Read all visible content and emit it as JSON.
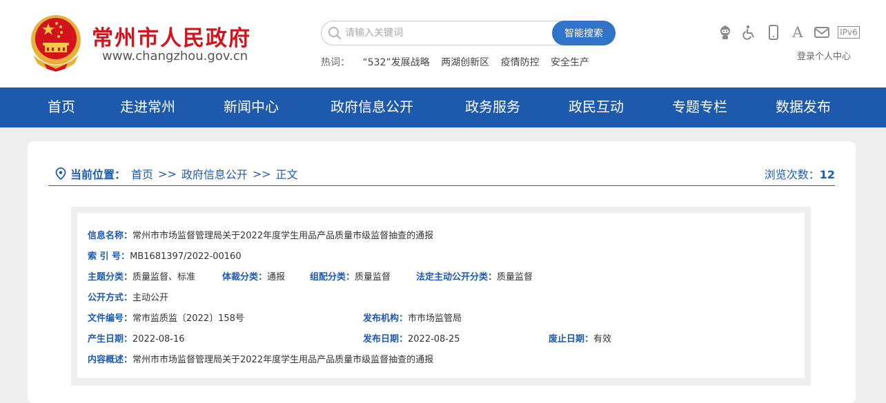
{
  "header": {
    "site_name": "常州市人民政府",
    "site_url": "www.changzhou.gov.cn",
    "emblem_icon": "national-emblem-icon",
    "brand_color": "#d3141d"
  },
  "search": {
    "placeholder": "请输入关键词",
    "value": "",
    "button_label": "智能搜索",
    "button_color": "#2f74c9"
  },
  "hot": {
    "label": "热词：",
    "items": [
      "“532”发展战略",
      "两湖创新区",
      "疫情防控",
      "安全生产"
    ]
  },
  "tools": {
    "icons": [
      "robot-icon",
      "accessibility-icon",
      "mobile-icon",
      "font-size-icon",
      "mail-icon",
      "ipv6-icon"
    ],
    "ipv6_text": "IPv6",
    "font_text": "A",
    "login_label": "登录个人中心"
  },
  "nav": {
    "bg_color": "#1d5aad",
    "items": [
      "首页",
      "走进常州",
      "新闻中心",
      "政府信息公开",
      "政务服务",
      "政民互动",
      "专题专栏",
      "数据发布"
    ]
  },
  "breadcrumb": {
    "label": "当前位置：",
    "items": [
      "首页",
      "政府信息公开",
      "正文"
    ],
    "separator": ">>"
  },
  "views": {
    "label": "浏览次数：",
    "count": "12"
  },
  "info": {
    "name_label": "信息名称：",
    "name_value": "常州市市场监督管理局关于2022年度学生用品产品质量市级监督抽查的通报",
    "index_label": "索 引 号：",
    "index_value": "MB1681397/2022-00160",
    "topic_label": "主题分类：",
    "topic_value": "质量监督、标准",
    "genre_label": "体裁分类：",
    "genre_value": "通报",
    "org_cat_label": "组配分类：",
    "org_cat_value": "质量监督",
    "legal_label": "法定主动公开分类：",
    "legal_value": "质量监督",
    "open_label": "公开方式：",
    "open_value": "主动公开",
    "doc_no_label": "文件编号：",
    "doc_no_value": "常市监质监〔2022〕158号",
    "publisher_label": "发布机构：",
    "publisher_value": "市市场监管局",
    "created_label": "产生日期：",
    "created_value": "2022-08-16",
    "published_label": "发布日期：",
    "published_value": "2022-08-25",
    "expire_label": "废止日期：",
    "expire_value": "有效",
    "summary_label": "内容概述：",
    "summary_value": "常州市市场监督管理局关于2022年度学生用品产品质量市级监督抽查的通报"
  }
}
